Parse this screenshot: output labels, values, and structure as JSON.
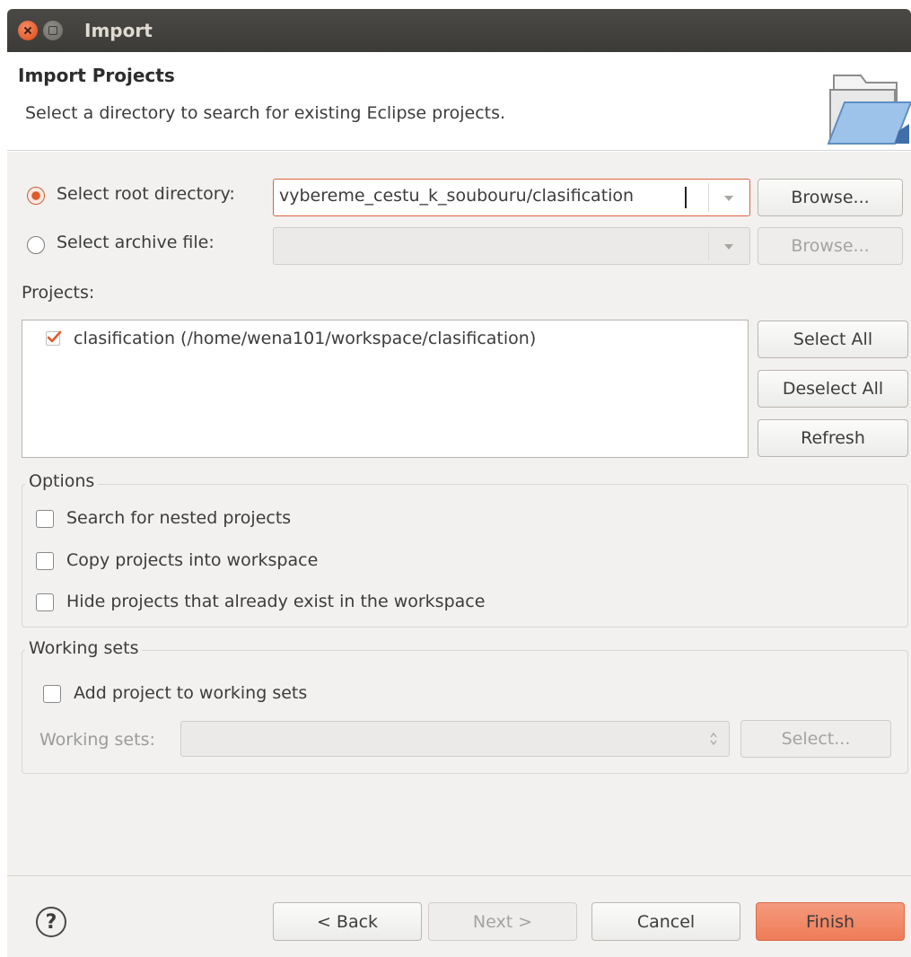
{
  "window": {
    "title": "Import"
  },
  "header": {
    "title": "Import Projects",
    "description": "Select a directory to search for existing Eclipse projects."
  },
  "source": {
    "root_directory": {
      "label": "Select root directory:",
      "selected": true,
      "value": "vybereme_cestu_k_soubouru/clasification",
      "browse_label": "Browse..."
    },
    "archive_file": {
      "label": "Select archive file:",
      "selected": false,
      "value": "",
      "browse_label": "Browse..."
    }
  },
  "projects": {
    "label": "Projects:",
    "items": [
      {
        "label": "clasification (/home/wena101/workspace/clasification)",
        "checked": true
      }
    ],
    "select_all_label": "Select All",
    "deselect_all_label": "Deselect All",
    "refresh_label": "Refresh"
  },
  "options": {
    "title": "Options",
    "search_nested": "Search for nested projects",
    "copy_projects": "Copy projects into workspace",
    "hide_existing": "Hide projects that already exist in the workspace"
  },
  "working_sets": {
    "title": "Working sets",
    "add_label": "Add project to working sets",
    "sets_label": "Working sets:",
    "sets_value": "",
    "select_label": "Select..."
  },
  "footer": {
    "help_glyph": "?",
    "back_label": "< Back",
    "next_label": "Next >",
    "cancel_label": "Cancel",
    "finish_label": "Finish"
  },
  "colors": {
    "accent": "#e05a2b",
    "titlebar": "#3c3b37",
    "finish": "#ee7c58"
  }
}
